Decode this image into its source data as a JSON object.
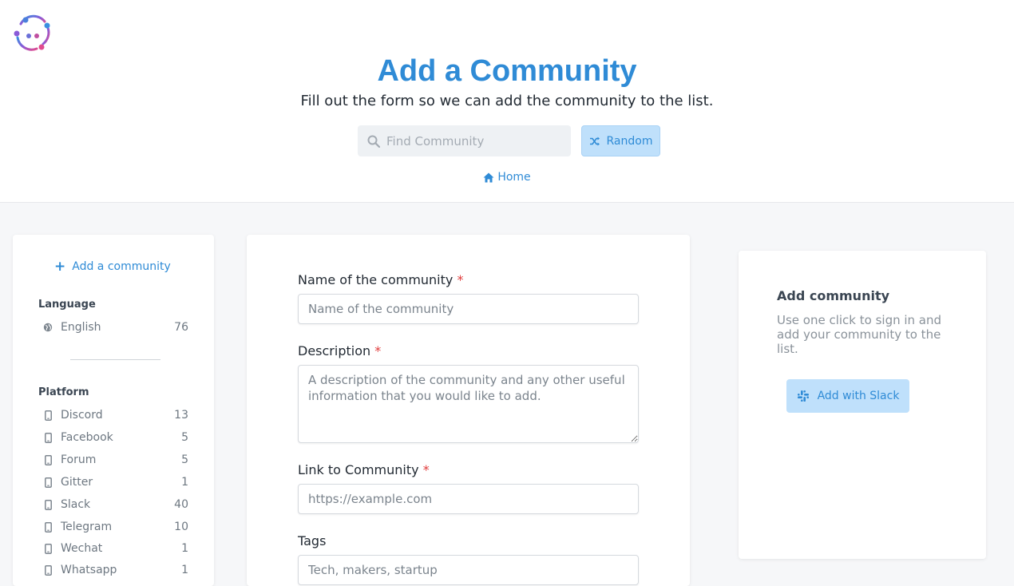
{
  "header": {
    "title": "Add a Community",
    "subtitle": "Fill out the form so we can add the community to the list.",
    "search_placeholder": "Find Community",
    "random_label": "Random",
    "home_label": "Home"
  },
  "sidebar": {
    "add_label": "Add a community",
    "language_title": "Language",
    "languages": [
      {
        "label": "English",
        "count": "76"
      }
    ],
    "platform_title": "Platform",
    "platforms": [
      {
        "label": "Discord",
        "count": "13"
      },
      {
        "label": "Facebook",
        "count": "5"
      },
      {
        "label": "Forum",
        "count": "5"
      },
      {
        "label": "Gitter",
        "count": "1"
      },
      {
        "label": "Slack",
        "count": "40"
      },
      {
        "label": "Telegram",
        "count": "10"
      },
      {
        "label": "Wechat",
        "count": "1"
      },
      {
        "label": "Whatsapp",
        "count": "1"
      }
    ]
  },
  "form": {
    "name_label": "Name of the community",
    "name_placeholder": "Name of the community",
    "description_label": "Description",
    "description_placeholder": "A description of the community and any other useful information that you would like to add.",
    "link_label": "Link to Community",
    "link_placeholder": "https://example.com",
    "tags_label": "Tags",
    "tags_placeholder": "Tech, makers, startup",
    "required_mark": "*"
  },
  "slack_panel": {
    "title": "Add community",
    "description": "Use one click to sign in and add your community to the list.",
    "button_label": "Add with Slack"
  },
  "colors": {
    "accent": "#2f8bd6",
    "button_bg": "#bfe0fb",
    "required": "#e03b3b"
  },
  "icons": {
    "logo": "community-logo-icon",
    "search": "search-icon",
    "random": "shuffle-icon",
    "home": "home-icon",
    "add": "plus-icon",
    "language": "globe-icon",
    "platform": "mobile-phone-icon",
    "slack": "slack-icon"
  }
}
